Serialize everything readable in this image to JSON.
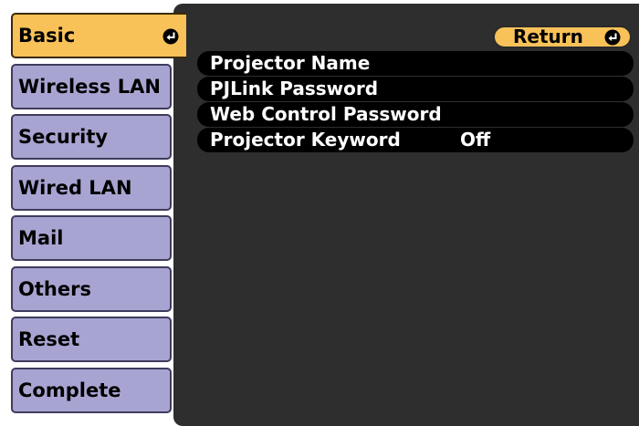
{
  "sidebar": {
    "tabs": [
      {
        "label": "Basic",
        "active": true
      },
      {
        "label": "Wireless LAN",
        "active": false
      },
      {
        "label": "Security",
        "active": false
      },
      {
        "label": "Wired LAN",
        "active": false
      },
      {
        "label": "Mail",
        "active": false
      },
      {
        "label": "Others",
        "active": false
      },
      {
        "label": "Reset",
        "active": false
      },
      {
        "label": "Complete",
        "active": false
      }
    ]
  },
  "panel": {
    "return_label": "Return",
    "items": [
      {
        "label": "Projector Name",
        "value": ""
      },
      {
        "label": "PJLink Password",
        "value": ""
      },
      {
        "label": "Web Control Password",
        "value": ""
      },
      {
        "label": "Projector Keyword",
        "value": "Off"
      }
    ]
  },
  "icons": {
    "enter": "enter-icon"
  },
  "colors": {
    "active_tab": "#f8c259",
    "inactive_tab": "#a8a4d2",
    "panel_bg": "#2e2e2e",
    "item_bg": "#000000",
    "item_text": "#ffffff"
  }
}
